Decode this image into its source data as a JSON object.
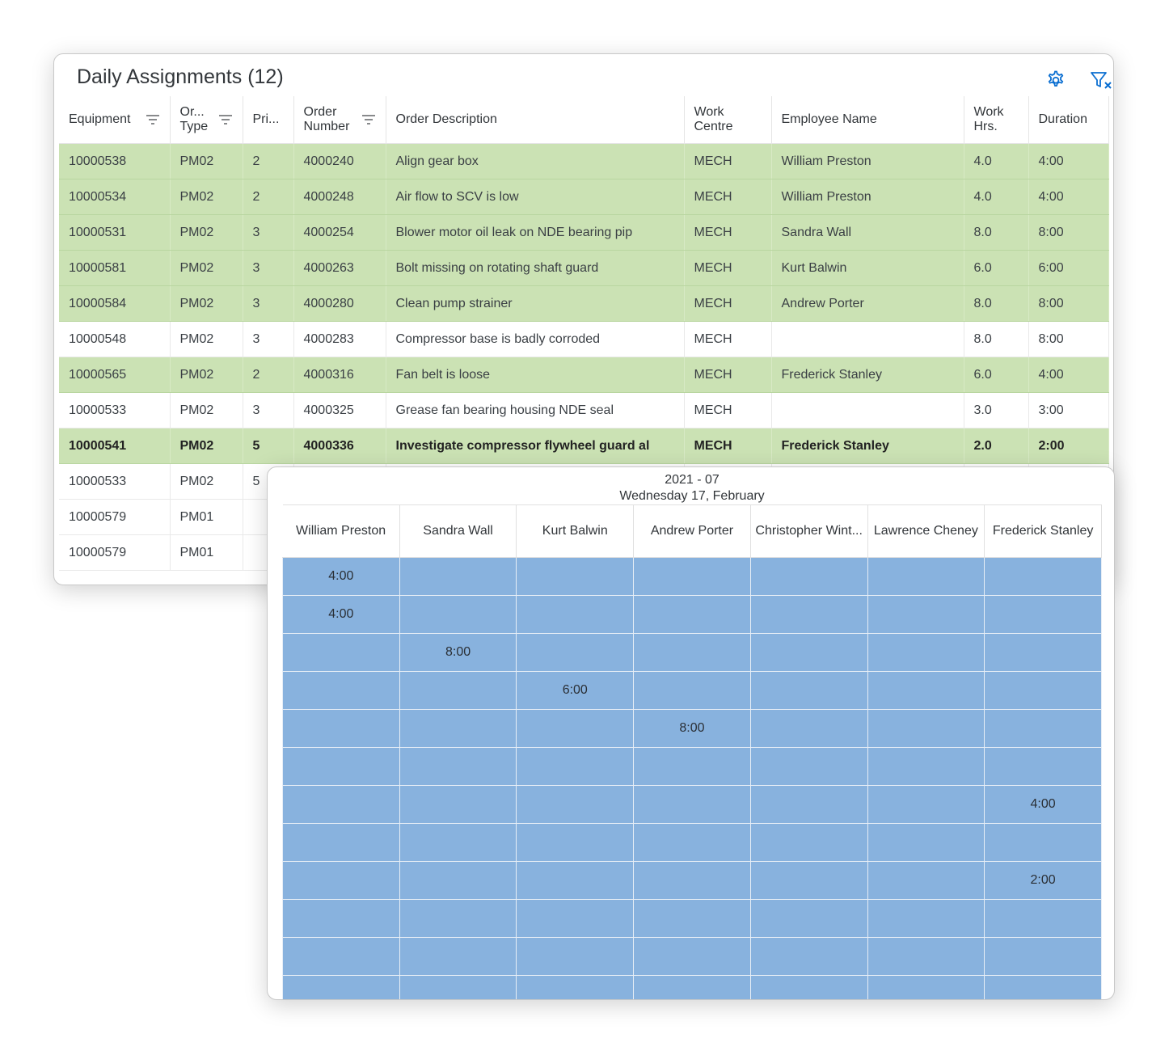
{
  "assignments": {
    "title": "Daily Assignments (12)",
    "columns": [
      "Equipment",
      "Or... Type",
      "Pri...",
      "Order Number",
      "Order Description",
      "Work Centre",
      "Employee Name",
      "Work Hrs.",
      "Duration"
    ],
    "rows": [
      {
        "equipment": "10000538",
        "order_type": "PM02",
        "priority": "2",
        "order_number": "4000240",
        "description": "Align gear box",
        "work_centre": "MECH",
        "employee": "William Preston",
        "work_hrs": "4.0",
        "duration": "4:00",
        "assigned": true
      },
      {
        "equipment": "10000534",
        "order_type": "PM02",
        "priority": "2",
        "order_number": "4000248",
        "description": "Air flow to SCV is low",
        "work_centre": "MECH",
        "employee": "William Preston",
        "work_hrs": "4.0",
        "duration": "4:00",
        "assigned": true
      },
      {
        "equipment": "10000531",
        "order_type": "PM02",
        "priority": "3",
        "order_number": "4000254",
        "description": "Blower motor oil leak on NDE bearing pip",
        "work_centre": "MECH",
        "employee": "Sandra Wall",
        "work_hrs": "8.0",
        "duration": "8:00",
        "assigned": true
      },
      {
        "equipment": "10000581",
        "order_type": "PM02",
        "priority": "3",
        "order_number": "4000263",
        "description": "Bolt missing on rotating shaft guard",
        "work_centre": "MECH",
        "employee": "Kurt Balwin",
        "work_hrs": "6.0",
        "duration": "6:00",
        "assigned": true
      },
      {
        "equipment": "10000584",
        "order_type": "PM02",
        "priority": "3",
        "order_number": "4000280",
        "description": "Clean pump strainer",
        "work_centre": "MECH",
        "employee": "Andrew Porter",
        "work_hrs": "8.0",
        "duration": "8:00",
        "assigned": true
      },
      {
        "equipment": "10000548",
        "order_type": "PM02",
        "priority": "3",
        "order_number": "4000283",
        "description": "Compressor base is badly corroded",
        "work_centre": "MECH",
        "employee": "",
        "work_hrs": "8.0",
        "duration": "8:00",
        "assigned": false
      },
      {
        "equipment": "10000565",
        "order_type": "PM02",
        "priority": "2",
        "order_number": "4000316",
        "description": "Fan belt is loose",
        "work_centre": "MECH",
        "employee": "Frederick Stanley",
        "work_hrs": "6.0",
        "duration": "4:00",
        "assigned": true
      },
      {
        "equipment": "10000533",
        "order_type": "PM02",
        "priority": "3",
        "order_number": "4000325",
        "description": "Grease fan bearing housing NDE seal",
        "work_centre": "MECH",
        "employee": "",
        "work_hrs": "3.0",
        "duration": "3:00",
        "assigned": false
      },
      {
        "equipment": "10000541",
        "order_type": "PM02",
        "priority": "5",
        "order_number": "4000336",
        "description": "Investigate compressor flywheel guard al",
        "work_centre": "MECH",
        "employee": "Frederick Stanley",
        "work_hrs": "2.0",
        "duration": "2:00",
        "assigned": true,
        "selected": true
      },
      {
        "equipment": "10000533",
        "order_type": "PM02",
        "priority": "5",
        "order_number": "",
        "description": "",
        "work_centre": "",
        "employee": "",
        "work_hrs": "",
        "duration": "",
        "assigned": false
      },
      {
        "equipment": "10000579",
        "order_type": "PM01",
        "priority": "",
        "order_number": "",
        "description": "",
        "work_centre": "",
        "employee": "",
        "work_hrs": "",
        "duration": "",
        "assigned": false
      },
      {
        "equipment": "10000579",
        "order_type": "PM01",
        "priority": "",
        "order_number": "",
        "description": "",
        "work_centre": "",
        "employee": "",
        "work_hrs": "",
        "duration": "",
        "assigned": false
      }
    ]
  },
  "calendar": {
    "week": "2021 - 07",
    "date": "Wednesday 17, February",
    "employees": [
      "William Preston",
      "Sandra Wall",
      "Kurt Balwin",
      "Andrew Porter",
      "Christopher Wint...",
      "Lawrence Cheney",
      "Frederick Stanley"
    ],
    "grid": [
      [
        "4:00",
        "",
        "",
        "",
        "",
        "",
        ""
      ],
      [
        "4:00",
        "",
        "",
        "",
        "",
        "",
        ""
      ],
      [
        "",
        "8:00",
        "",
        "",
        "",
        "",
        ""
      ],
      [
        "",
        "",
        "6:00",
        "",
        "",
        "",
        ""
      ],
      [
        "",
        "",
        "",
        "8:00",
        "",
        "",
        ""
      ],
      [
        "",
        "",
        "",
        "",
        "",
        "",
        ""
      ],
      [
        "",
        "",
        "",
        "",
        "",
        "",
        "4:00"
      ],
      [
        "",
        "",
        "",
        "",
        "",
        "",
        ""
      ],
      [
        "",
        "",
        "",
        "",
        "",
        "",
        "2:00"
      ],
      [
        "",
        "",
        "",
        "",
        "",
        "",
        ""
      ],
      [
        "",
        "",
        "",
        "",
        "",
        "",
        ""
      ],
      [
        "",
        "",
        "",
        "",
        "",
        "",
        ""
      ]
    ]
  },
  "colors": {
    "assigned_row": "#cbe2b4",
    "calendar_cell": "#88b2de",
    "icon_accent": "#0a6ed1"
  },
  "icons": [
    "gear-icon",
    "filter-clear-icon",
    "column-filter-icon"
  ]
}
